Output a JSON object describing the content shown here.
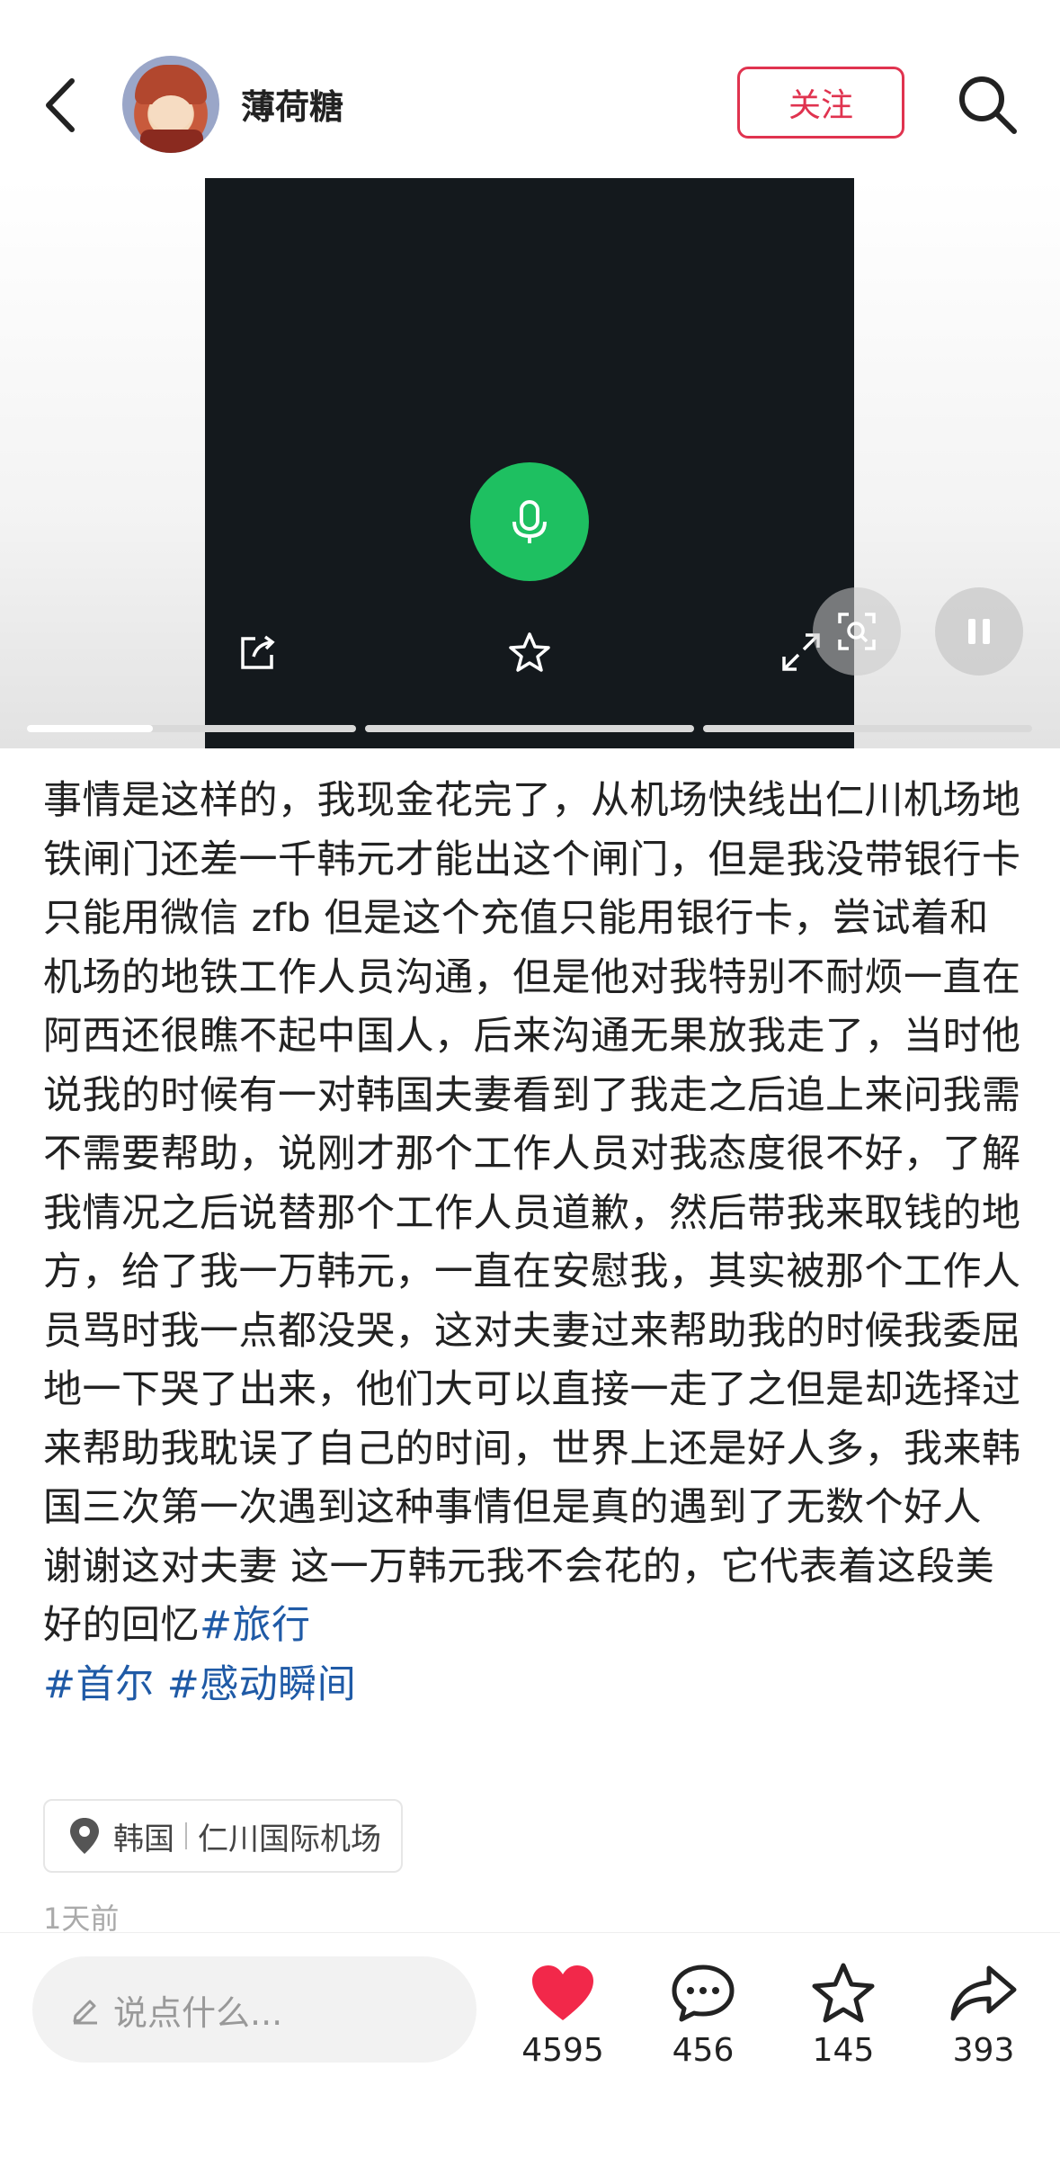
{
  "header": {
    "username": "薄荷糖",
    "follow_label": "关注"
  },
  "media": {
    "slide_count": 3,
    "active_slide": 1
  },
  "post": {
    "body": "事情是这样的，我现金花完了，从机场快线出仁川机场地铁闸门还差一千韩元才能出这个闸门，但是我没带银行卡只能用微信 zfb 但是这个充值只能用银行卡，尝试着和机场的地铁工作人员沟通，但是他对我特别不耐烦一直在阿西还很瞧不起中国人，后来沟通无果放我走了，当时他说我的时候有一对韩国夫妻看到了我走之后追上来问我需不需要帮助，说刚才那个工作人员对我态度很不好，了解我情况之后说替那个工作人员道歉，然后带我来取钱的地方，给了我一万韩元，一直在安慰我，其实被那个工作人员骂时我一点都没哭，这对夫妻过来帮助我的时候我委屈地一下哭了出来，他们大可以直接一走了之但是却选择过来帮助我耽误了自己的时间，世界上还是好人多，我来韩国三次第一次遇到这种事情但是真的遇到了无数个好人 谢谢这对夫妻 这一万韩元我不会花的，它代表着这段美好的回忆",
    "tags": [
      "#旅行",
      "#首尔",
      "#感动瞬间"
    ],
    "location_country": "韩国",
    "location_place": "仁川国际机场",
    "time_ago": "1天前"
  },
  "bottom_bar": {
    "comment_placeholder": "说点什么...",
    "likes": "4595",
    "comments": "456",
    "favorites": "145",
    "shares": "393"
  },
  "colors": {
    "accent": "#e0334f",
    "tag": "#1f5aa6",
    "mic": "#1ec061",
    "like": "#f2284a"
  }
}
